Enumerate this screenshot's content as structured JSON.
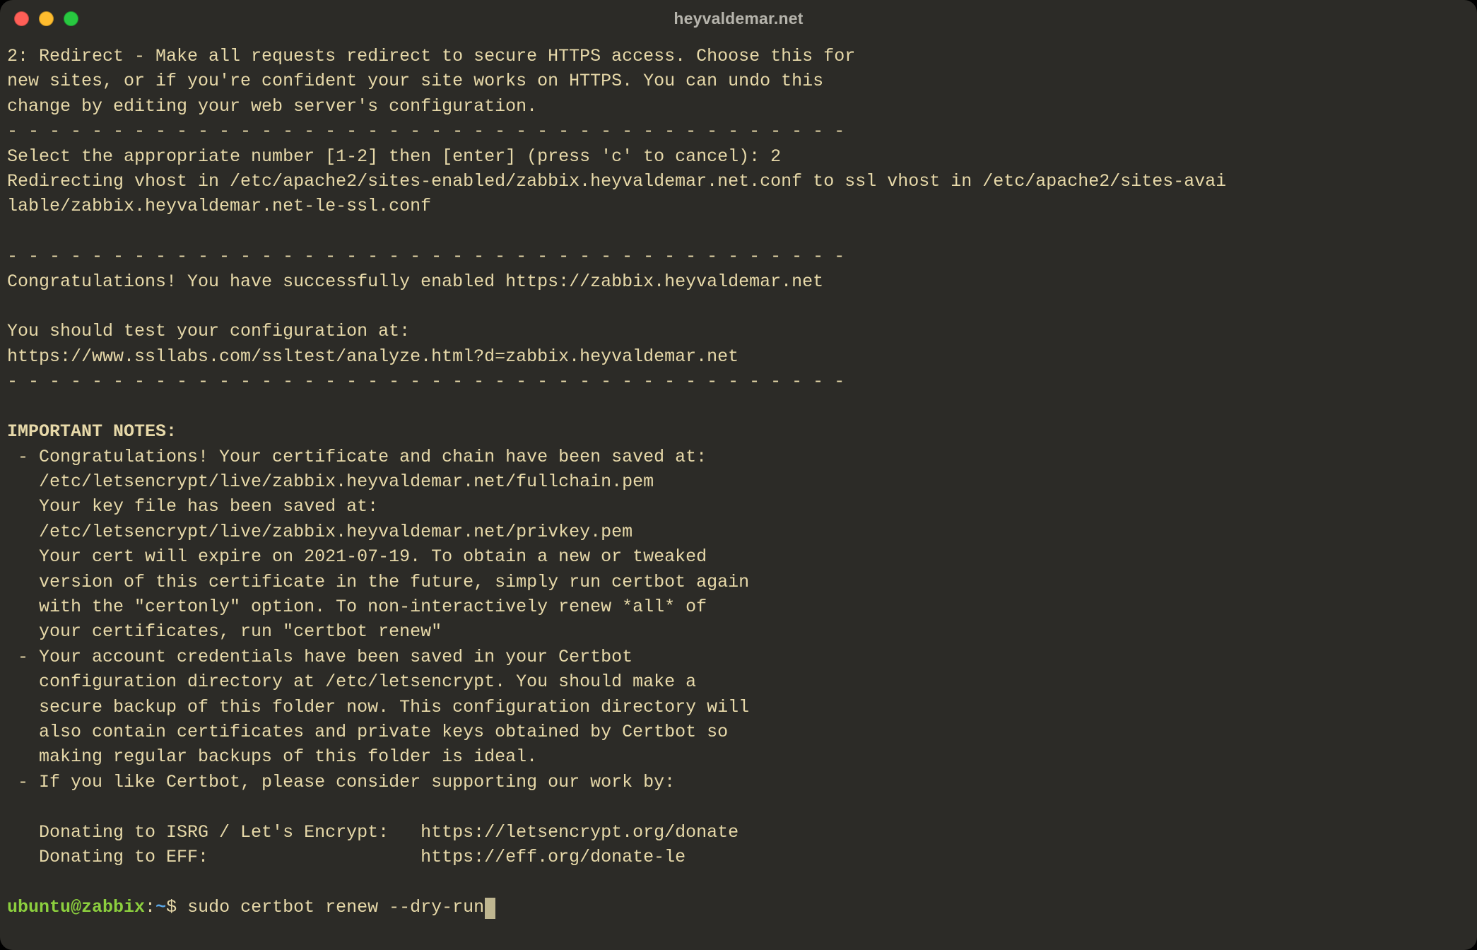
{
  "window": {
    "title": "heyvaldemar.net"
  },
  "terminal": {
    "lines": {
      "l00": "2: Redirect - Make all requests redirect to secure HTTPS access. Choose this for",
      "l01": "new sites, or if you're confident your site works on HTTPS. You can undo this",
      "l02": "change by editing your web server's configuration.",
      "l03": "- - - - - - - - - - - - - - - - - - - - - - - - - - - - - - - - - - - - - - - -",
      "l04": "Select the appropriate number [1-2] then [enter] (press 'c' to cancel): 2",
      "l05": "Redirecting vhost in /etc/apache2/sites-enabled/zabbix.heyvaldemar.net.conf to ssl vhost in /etc/apache2/sites-avai",
      "l06": "lable/zabbix.heyvaldemar.net-le-ssl.conf",
      "l07": "",
      "l08": "- - - - - - - - - - - - - - - - - - - - - - - - - - - - - - - - - - - - - - - -",
      "l09": "Congratulations! You have successfully enabled https://zabbix.heyvaldemar.net",
      "l10": "",
      "l11": "You should test your configuration at:",
      "l12": "https://www.ssllabs.com/ssltest/analyze.html?d=zabbix.heyvaldemar.net",
      "l13": "- - - - - - - - - - - - - - - - - - - - - - - - - - - - - - - - - - - - - - - -",
      "l14": "",
      "l15": "IMPORTANT NOTES:",
      "l16": " - Congratulations! Your certificate and chain have been saved at:",
      "l17": "   /etc/letsencrypt/live/zabbix.heyvaldemar.net/fullchain.pem",
      "l18": "   Your key file has been saved at:",
      "l19": "   /etc/letsencrypt/live/zabbix.heyvaldemar.net/privkey.pem",
      "l20": "   Your cert will expire on 2021-07-19. To obtain a new or tweaked",
      "l21": "   version of this certificate in the future, simply run certbot again",
      "l22": "   with the \"certonly\" option. To non-interactively renew *all* of",
      "l23": "   your certificates, run \"certbot renew\"",
      "l24": " - Your account credentials have been saved in your Certbot",
      "l25": "   configuration directory at /etc/letsencrypt. You should make a",
      "l26": "   secure backup of this folder now. This configuration directory will",
      "l27": "   also contain certificates and private keys obtained by Certbot so",
      "l28": "   making regular backups of this folder is ideal.",
      "l29": " - If you like Certbot, please consider supporting our work by:",
      "l30": "",
      "l31": "   Donating to ISRG / Let's Encrypt:   https://letsencrypt.org/donate",
      "l32": "   Donating to EFF:                    https://eff.org/donate-le",
      "l33": ""
    },
    "prompt": {
      "user_host": "ubuntu@zabbix",
      "colon": ":",
      "path": "~",
      "dollar": "$ ",
      "command": "sudo certbot renew --dry-run"
    }
  }
}
